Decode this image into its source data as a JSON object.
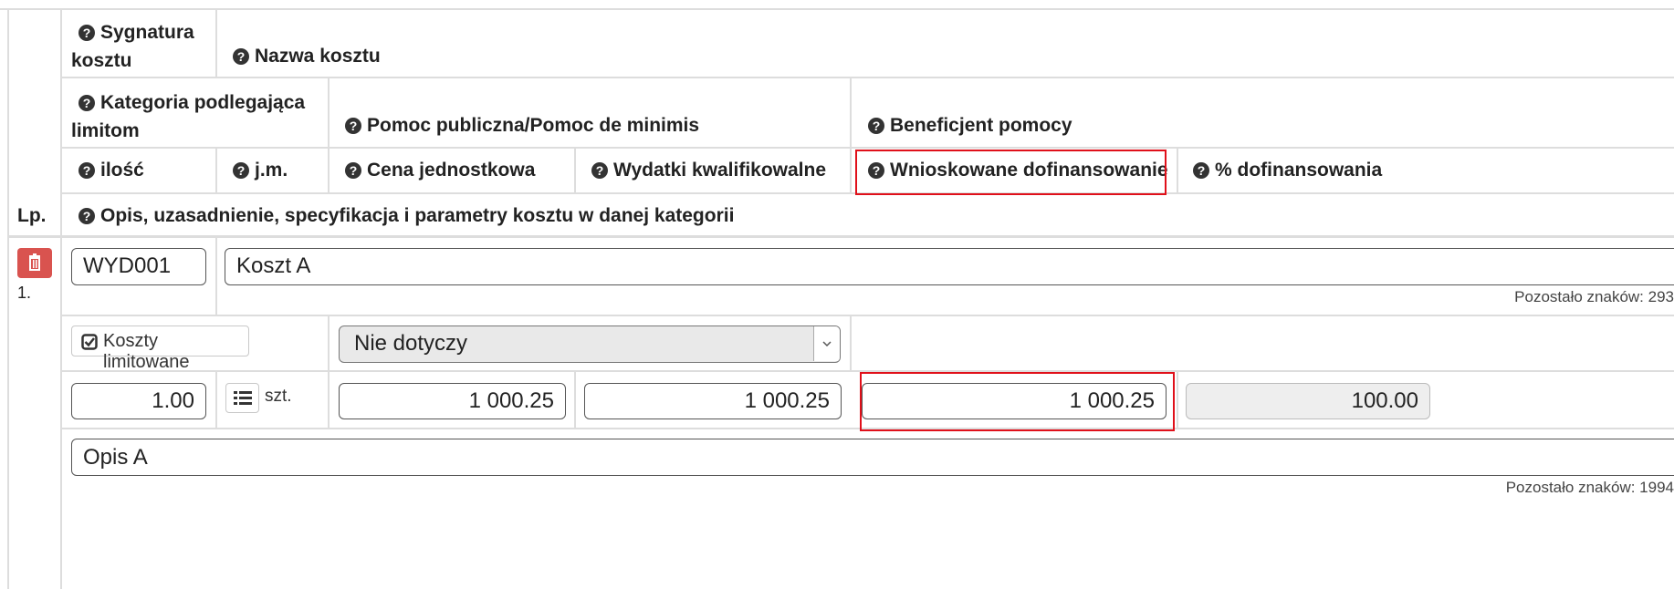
{
  "columns": {
    "lp": "Lp.",
    "sygnatura": "Sygnatura kosztu",
    "sygnatura_line1": "Sygnatura",
    "sygnatura_line2": "kosztu",
    "nazwa": "Nazwa kosztu",
    "kategoria_line1": "Kategoria podlegająca",
    "kategoria_line2": "limitom",
    "pomoc_publiczna": "Pomoc publiczna/Pomoc de minimis",
    "beneficjent": "Beneficjent pomocy",
    "ilosc": "ilość",
    "jm": "j.m.",
    "cena": "Cena jednostkowa",
    "wydatki": "Wydatki kwalifikowalne",
    "wnioskowane": "Wnioskowane dofinansowanie",
    "procent": "% dofinansowania",
    "opis": "Opis, uzasadnienie, specyfikacja i parametry kosztu w danej kategorii"
  },
  "row": {
    "number": "1.",
    "sygnatura_value": "WYD001",
    "nazwa_value": "Koszt A",
    "nazwa_remaining": "Pozostało znaków: 293",
    "koszty_limitowane_label": "Koszty limitowane",
    "pomoc_select_value": "Nie dotyczy",
    "ilosc_value": "1.00",
    "jm_value": "szt.",
    "cena_value": "1 000.25",
    "wydatki_value": "1 000.25",
    "wnioskowane_value": "1 000.25",
    "procent_value": "100.00",
    "opis_value": "Opis A",
    "opis_remaining": "Pozostało znaków: 1994"
  },
  "icons": {
    "help": "question-circle-icon",
    "delete": "trash-icon",
    "checkbox": "check-square-icon",
    "list": "list-icon",
    "dropdown": "chevron-down-icon"
  },
  "colors": {
    "highlight": "#e0101a",
    "delete_button": "#d9534f",
    "border": "#dddddd"
  }
}
